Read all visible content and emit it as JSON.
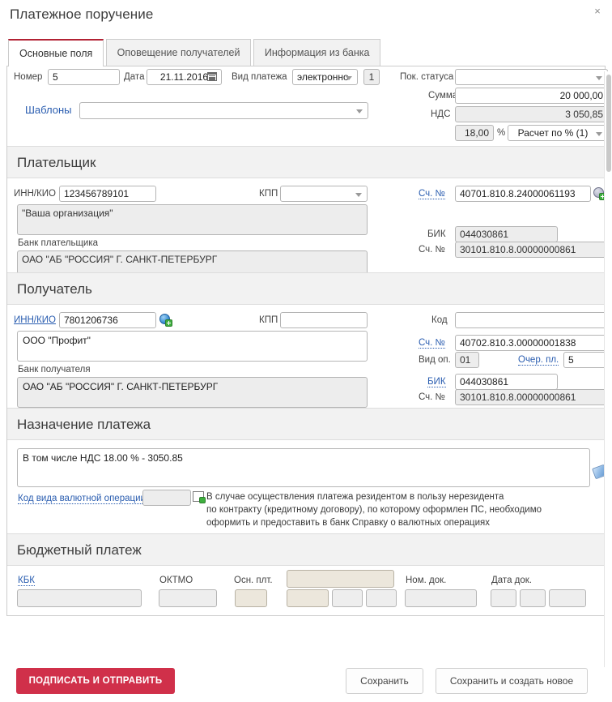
{
  "window": {
    "title": "Платежное поручение",
    "close_label": "×"
  },
  "tabs": [
    {
      "label": "Основные поля",
      "active": true
    },
    {
      "label": "Оповещение получателей",
      "active": false
    },
    {
      "label": "Информация из банка",
      "active": false
    }
  ],
  "top": {
    "number_label": "Номер",
    "number_value": "5",
    "date_label": "Дата",
    "date_value": "21.11.2016",
    "calendar_icon": "calendar-icon",
    "payment_kind_label": "Вид платежа",
    "payment_kind_value": "электронно",
    "payment_kind_code": "1",
    "templates_label": "Шаблоны",
    "templates_value": "",
    "status_label": "Пок. статуса",
    "status_value": "",
    "amount_label": "Сумма",
    "amount_value": "20 000,00",
    "vat_label": "НДС",
    "vat_value": "3 050,85",
    "vat_rate_value": "18,00",
    "percent_sign": "%",
    "calc_mode_value": "Расчет по % (1)"
  },
  "payer": {
    "heading": "Плательщик",
    "inn_label": "ИНН/КИО",
    "inn_value": "123456789101",
    "kpp_label": "КПП",
    "kpp_value": "",
    "name_value": "\"Ваша организация\"",
    "bank_label": "Банк плательщика",
    "bank_value": "ОАО \"АБ \"РОССИЯ\" Г. САНКТ-ПЕТЕРБУРГ",
    "account_label": "Сч. №",
    "account_value": "40701.810.8.24000061193",
    "account_icon": "globe-add-icon",
    "bik_label": "БИК",
    "bik_value": "044030861",
    "corr_account_label": "Сч. №",
    "corr_account_value": "30101.810.8.00000000861"
  },
  "recipient": {
    "heading": "Получатель",
    "inn_label": "ИНН/КИО",
    "inn_value": "7801206736",
    "inn_icon": "globe-add-icon",
    "kpp_label": "КПП",
    "kpp_value": "",
    "name_value": "ООО \"Профит\"",
    "bank_label": "Банк получателя",
    "bank_value": "ОАО \"АБ \"РОССИЯ\" Г. САНКТ-ПЕТЕРБУРГ",
    "code_label": "Код",
    "code_value": "",
    "account_label": "Сч. №",
    "account_value": "40702.810.3.00000001838",
    "op_kind_label": "Вид оп.",
    "op_kind_value": "01",
    "queue_label": "Очер. пл.",
    "queue_value": "5",
    "bik_label": "БИК",
    "bik_value": "044030861",
    "corr_account_label": "Сч. №",
    "corr_account_value": "30101.810.8.00000000861"
  },
  "purpose": {
    "heading": "Назначение платежа",
    "text_value": "В том числе НДС 18.00 % - 3050.85",
    "attach_icon": "pencil-icon",
    "cvo_label": "Код вида валютной операции",
    "cvo_value": "",
    "cvo_icon": "add-document-icon",
    "hint_line1": "В случае осуществления платежа резидентом в пользу нерезидента",
    "hint_line2": "по контракту (кредитному договору), по которому оформлен ПС, необходимо",
    "hint_line3": "оформить и предоставить в банк Справку о валютных операциях"
  },
  "budget": {
    "heading": "Бюджетный платеж",
    "kbk_label": "КБК",
    "kbk_value": "",
    "oktmo_label": "ОКТМО",
    "oktmo_value": "",
    "basis_label": "Осн. плт.",
    "basis_value": "",
    "period_value": "",
    "period_a_value": "",
    "period_b_value": "",
    "period_c_value": "",
    "doc_num_label": "Ном. док.",
    "doc_num_value": "",
    "doc_date_label": "Дата док.",
    "doc_date_a": "",
    "doc_date_b": "",
    "doc_date_c": ""
  },
  "footer": {
    "sign_send_label": "ПОДПИСАТЬ И ОТПРАВИТЬ",
    "save_label": "Сохранить",
    "save_new_label": "Сохранить и создать новое"
  },
  "colors": {
    "accent_red": "#d0304a",
    "tab_accent": "#b22234",
    "link_blue": "#2a5db0",
    "section_bg": "#f2f2f2",
    "readonly_bg": "#ededed",
    "beige_bg": "#ece7dc"
  }
}
